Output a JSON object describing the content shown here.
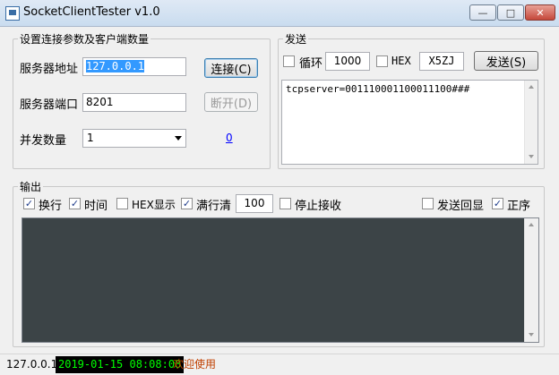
{
  "window": {
    "title": "SocketClientTester v1.0",
    "minimize": "—",
    "maximize": "□",
    "close": "✕"
  },
  "connection": {
    "legend": "设置连接参数及客户端数量",
    "server_address_label": "服务器地址",
    "server_address_value": "127.0.0.1",
    "connect_button": "连接(C)",
    "server_port_label": "服务器端口",
    "server_port_value": "8201",
    "disconnect_button": "断开(D)",
    "concurrency_label": "并发数量",
    "concurrency_value": "1",
    "count_link": "0"
  },
  "send": {
    "legend": "发送",
    "loop_label": "循环",
    "loop_checked": false,
    "interval_value": "1000",
    "hex_label": "HEX",
    "hex_checked": false,
    "code_value": "X5ZJ",
    "send_button": "发送(S)",
    "message": "tcpserver=001110001100011100###"
  },
  "output": {
    "legend": "输出",
    "options": [
      {
        "label": "换行",
        "checked": true
      },
      {
        "label": "时间",
        "checked": true
      },
      {
        "label": "HEX显示",
        "checked": false
      },
      {
        "label": "满行清",
        "checked": true
      },
      {
        "label": "停止接收",
        "checked": false
      },
      {
        "label": "发送回显",
        "checked": false
      },
      {
        "label": "正序",
        "checked": true
      }
    ],
    "line_limit_value": "100"
  },
  "status": {
    "ip": "127.0.0.1",
    "datetime": "2019-01-15 08:08:08",
    "welcome": "欢迎使用",
    "datetime_color": "#00ff00",
    "welcome_color": "#c04000"
  }
}
